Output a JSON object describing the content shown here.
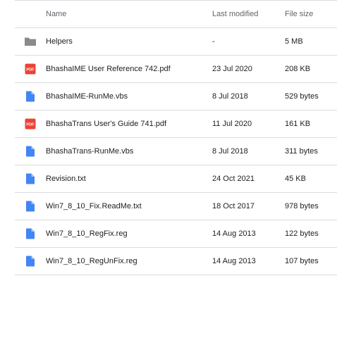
{
  "columns": {
    "name": "Name",
    "modified": "Last modified",
    "size": "File size"
  },
  "files": [
    {
      "name": "Helpers",
      "modified": "-",
      "size": "5 MB",
      "icon": "folder-icon"
    },
    {
      "name": "BhashaIME User Reference 742.pdf",
      "modified": "23 Jul 2020",
      "size": "208 KB",
      "icon": "pdf-icon"
    },
    {
      "name": "BhashaIME-RunMe.vbs",
      "modified": "8 Jul 2018",
      "size": "529 bytes",
      "icon": "file-icon"
    },
    {
      "name": "BhashaTrans User's Guide 741.pdf",
      "modified": "11 Jul 2020",
      "size": "161 KB",
      "icon": "pdf-icon"
    },
    {
      "name": "BhashaTrans-RunMe.vbs",
      "modified": "8 Jul 2018",
      "size": "311 bytes",
      "icon": "file-icon"
    },
    {
      "name": "Revision.txt",
      "modified": "24 Oct 2021",
      "size": "45 KB",
      "icon": "file-icon"
    },
    {
      "name": "Win7_8_10_Fix.ReadMe.txt",
      "modified": "18 Oct 2017",
      "size": "978 bytes",
      "icon": "file-icon"
    },
    {
      "name": "Win7_8_10_RegFix.reg",
      "modified": "14 Aug 2013",
      "size": "122 bytes",
      "icon": "file-icon"
    },
    {
      "name": "Win7_8_10_RegUnFix.reg",
      "modified": "14 Aug 2013",
      "size": "107 bytes",
      "icon": "file-icon"
    }
  ],
  "colors": {
    "folder": "#8a8a8a",
    "pdf": "#ea4335",
    "file": "#4285f4",
    "divider": "#dadce0"
  }
}
